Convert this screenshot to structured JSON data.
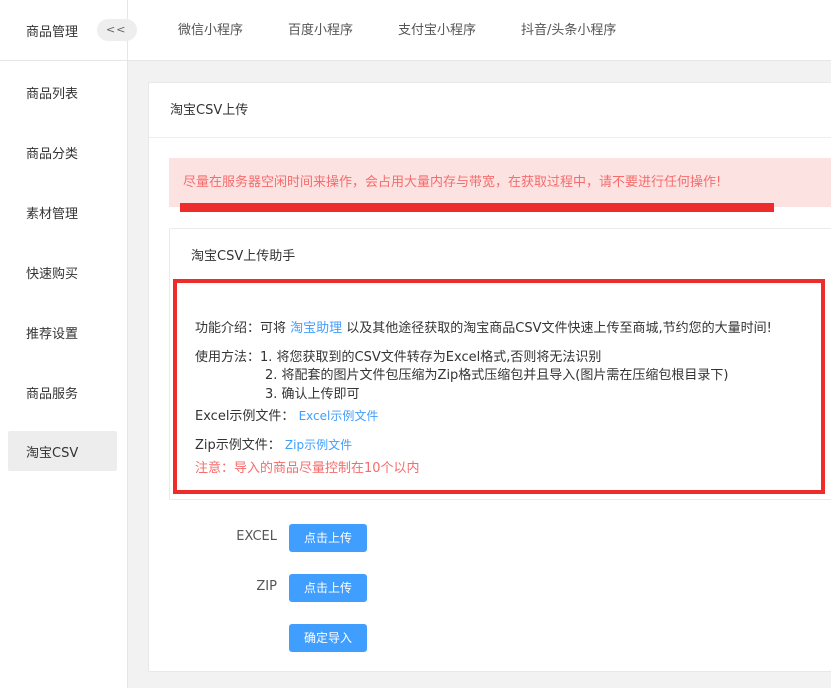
{
  "sidebar": {
    "title": "商品管理",
    "collapse_label": "<<",
    "items": [
      {
        "label": "商品列表"
      },
      {
        "label": "商品分类"
      },
      {
        "label": "素材管理"
      },
      {
        "label": "快速购买"
      },
      {
        "label": "推荐设置"
      },
      {
        "label": "商品服务"
      },
      {
        "label": "淘宝CSV"
      }
    ]
  },
  "topnav": {
    "tabs": [
      {
        "label": "微信小程序"
      },
      {
        "label": "百度小程序"
      },
      {
        "label": "支付宝小程序"
      },
      {
        "label": "抖音/头条小程序"
      }
    ]
  },
  "card": {
    "title": "淘宝CSV上传",
    "alert": "尽量在服务器空闲时间来操作，会占用大量内存与带宽，在获取过程中，请不要进行任何操作!",
    "helper": {
      "title": "淘宝CSV上传助手",
      "intro_prefix": "功能介绍：可将 ",
      "intro_link": "淘宝助理",
      "intro_suffix": " 以及其他途径获取的淘宝商品CSV文件快速上传至商城,节约您的大量时间!",
      "usage_prefix": "使用方法：",
      "usage_steps": [
        "1. 将您获取到的CSV文件转存为Excel格式,否则将无法识别",
        "2. 将配套的图片文件包压缩为Zip格式压缩包并且导入(图片需在压缩包根目录下)",
        "3. 确认上传即可"
      ],
      "excel_label": "Excel示例文件：",
      "excel_link": "Excel示例文件",
      "zip_label": "Zip示例文件：",
      "zip_link": "Zip示例文件",
      "notice": "注意：导入的商品尽量控制在10个以内"
    },
    "form": {
      "excel_label": "EXCEL",
      "excel_button": "点击上传",
      "zip_label": "ZIP",
      "zip_button": "点击上传",
      "confirm_button": "确定导入"
    }
  }
}
